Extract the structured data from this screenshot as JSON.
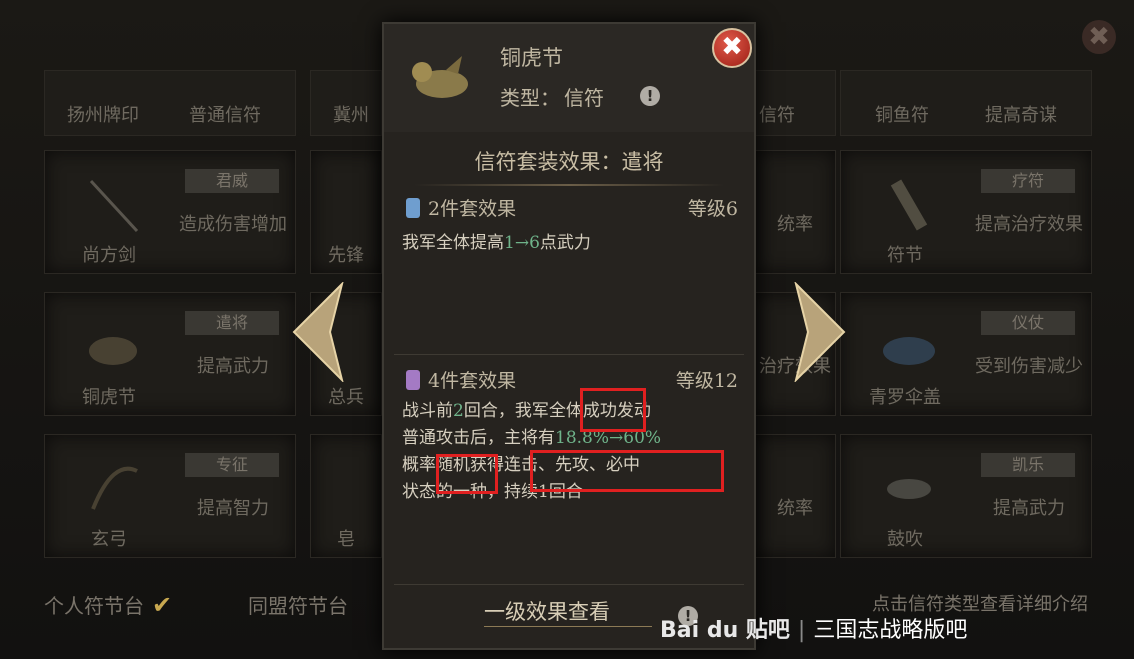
{
  "bg_close": "✖",
  "grid": {
    "top_row": [
      "扬州牌印",
      "普通信符",
      "冀州",
      "信符",
      "铜鱼符",
      "提高奇谋"
    ],
    "cells": [
      {
        "name": "尚方剑",
        "tag": "君威",
        "desc": "造成伤害增加"
      },
      {
        "name": "先锋",
        "tag": "",
        "desc": ""
      },
      {
        "name": "",
        "tag": "",
        "desc": "统率"
      },
      {
        "name": "符节",
        "tag": "疗符",
        "desc": "提高治疗效果"
      },
      {
        "name": "铜虎节",
        "tag": "遣将",
        "desc": "提高武力"
      },
      {
        "name": "总兵",
        "tag": "",
        "desc": ""
      },
      {
        "name": "",
        "tag": "",
        "desc": "治疗效果"
      },
      {
        "name": "青罗伞盖",
        "tag": "仪仗",
        "desc": "受到伤害减少"
      },
      {
        "name": "玄弓",
        "tag": "专征",
        "desc": "提高智力"
      },
      {
        "name": "皂",
        "tag": "",
        "desc": ""
      },
      {
        "name": "",
        "tag": "",
        "desc": "统率"
      },
      {
        "name": "鼓吹",
        "tag": "凯乐",
        "desc": "提高武力"
      }
    ]
  },
  "footer": {
    "personal": "个人符节台",
    "check": "✔",
    "alliance": "同盟符节台",
    "hint": "点击信符类型查看详细介绍"
  },
  "watermark": {
    "logo": "Bai du 贴吧",
    "sep": "|",
    "bar": "三国志战略版吧"
  },
  "popup": {
    "item_name": "铜虎节",
    "type_label": "类型：",
    "type_value": "信符",
    "info": "!",
    "close": "✖",
    "set_title": "信符套装效果：遣将",
    "effect2": {
      "head": "2件套效果",
      "level": "等级6",
      "text_a": "我军全体提高",
      "from": "1",
      "arrow": "→",
      "to": "6",
      "text_b": "点武力"
    },
    "effect4": {
      "head": "4件套效果",
      "level": "等级12",
      "line1_a": "战斗前",
      "line1_n": "2",
      "line1_b": "回合，我军全体成功发动",
      "line2_a": "普通攻击后，主将有",
      "line2_p": "18.8%→60%",
      "line3": "概率随机获得连击、先攻、必中",
      "line4": "状态的一种，持续1回合"
    },
    "bottom_link": "一级效果查看"
  },
  "colors": {
    "highlight": "#6fb38a",
    "annotation_box": "#e02020",
    "close_red": "#c2392b"
  }
}
